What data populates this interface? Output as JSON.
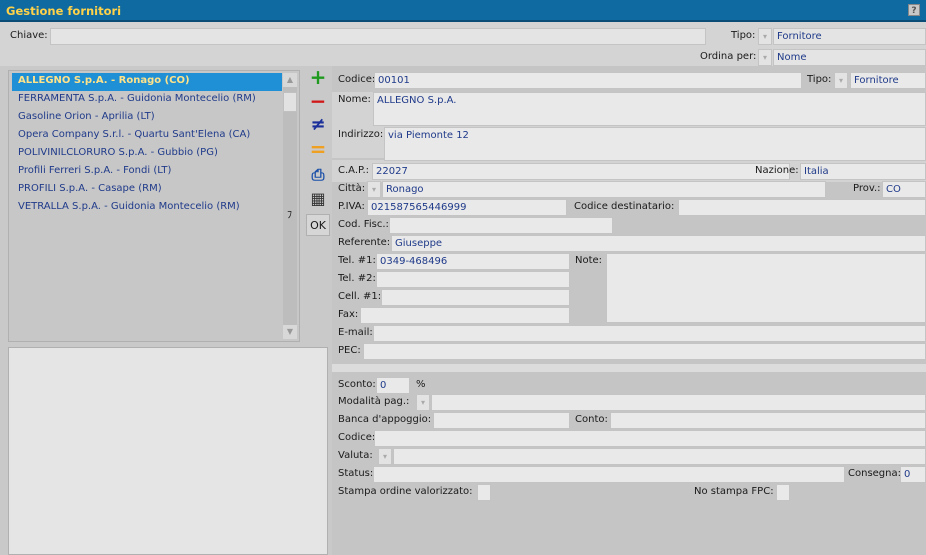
{
  "window": {
    "title": "Gestione fornitori",
    "help": "?"
  },
  "search": {
    "label": "Chiave:",
    "value": ""
  },
  "filter": {
    "tipo_label": "Tipo:",
    "tipo_value": "Fornitore",
    "ordina_label": "Ordina per:",
    "ordina_value": "Nome"
  },
  "list": {
    "items": [
      "ALLEGNO S.p.A. - Ronago (CO)",
      "FERRAMENTA S.p.A. - Guidonia Montecelio (RM)",
      "Gasoline Orion - Aprilia (LT)",
      "Opera Company S.r.l. - Quartu Sant'Elena (CA)",
      "POLIVINILCLORURO S.p.A. - Gubbio (PG)",
      "Profili Ferreri S.p.A. - Fondi (LT)",
      "PROFILI S.p.A. - Casape (RM)",
      "VETRALLA S.p.A. - Guidonia Montecelio (RM)"
    ],
    "scroll_up": "▲",
    "scroll_down": "▼"
  },
  "toolbar": {
    "add": "+",
    "remove": "−",
    "diff": "≠",
    "equal": "=",
    "print": "⎙",
    "table": "▦",
    "ok": "OK",
    "marker": "ﾌ"
  },
  "colors": {
    "add": "#1f9a1f",
    "remove": "#d01818",
    "diff": "#1a2f9a",
    "equal": "#f0a020",
    "print": "#1a4fa8"
  },
  "detail": {
    "codice_label": "Codice:",
    "codice": "00101",
    "tipo_label": "Tipo:",
    "tipo": "Fornitore",
    "nome_label": "Nome:",
    "nome": "ALLEGNO S.p.A.",
    "indirizzo_label": "Indirizzo:",
    "indirizzo": "via Piemonte 12",
    "cap_label": "C.A.P.:",
    "cap": "22027",
    "nazione_label": "Nazione:",
    "nazione": "Italia",
    "citta_label": "Città:",
    "citta": "Ronago",
    "prov_label": "Prov.:",
    "prov": "CO",
    "piva_label": "P.IVA:",
    "piva": "021587565446999",
    "coddest_label": "Codice destinatario:",
    "coddest": "",
    "codfisc_label": "Cod. Fisc.:",
    "codfisc": "",
    "referente_label": "Referente:",
    "referente": "Giuseppe",
    "tel1_label": "Tel. #1:",
    "tel1": "0349-468496",
    "note_label": "Note:",
    "note": "",
    "tel2_label": "Tel. #2:",
    "tel2": "",
    "cell1_label": "Cell. #1:",
    "cell1": "",
    "fax_label": "Fax:",
    "fax": "",
    "email_label": "E-mail:",
    "email": "",
    "pec_label": "PEC:",
    "pec": "",
    "sconto_label": "Sconto:",
    "sconto": "0",
    "sconto_unit": "%",
    "modpag_label": "Modalità pag.:",
    "modpag": "",
    "banca_label": "Banca d'appoggio:",
    "banca": "",
    "conto_label": "Conto:",
    "conto": "",
    "codice2_label": "Codice:",
    "codice2": "",
    "valuta_label": "Valuta:",
    "valuta": "",
    "status_label": "Status:",
    "status": "",
    "consegna_label": "Consegna:",
    "consegna": "0",
    "stampa_label": "Stampa ordine valorizzato:",
    "nofpc_label": "No stampa FPC:"
  }
}
